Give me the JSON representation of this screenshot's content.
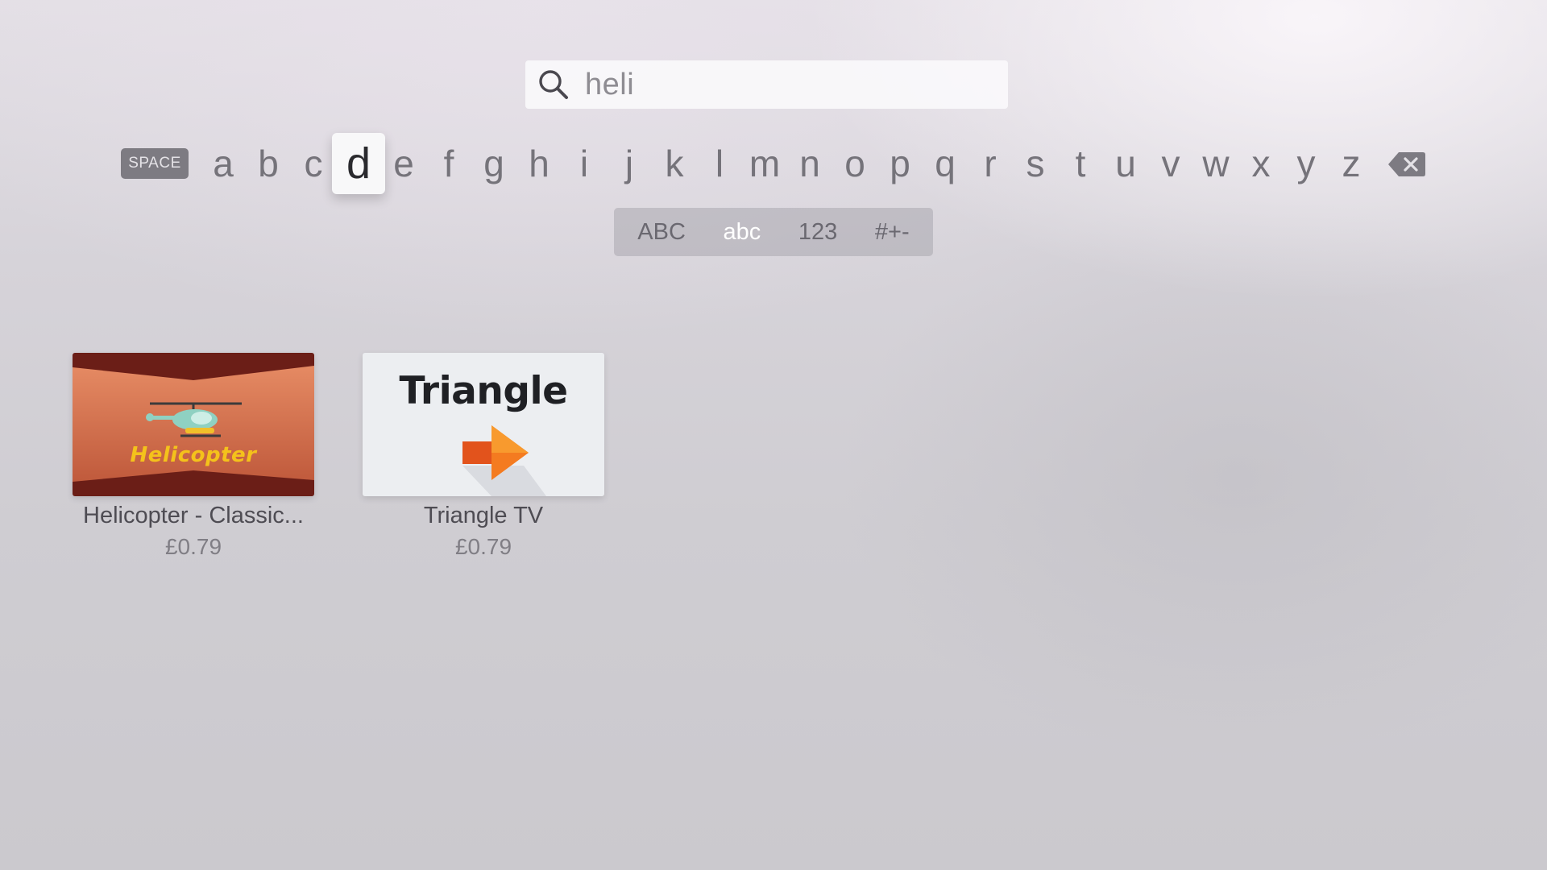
{
  "search": {
    "icon": "search-icon",
    "query": "heli"
  },
  "keyboard": {
    "space_label": "SPACE",
    "letters": [
      "a",
      "b",
      "c",
      "d",
      "e",
      "f",
      "g",
      "h",
      "i",
      "j",
      "k",
      "l",
      "m",
      "n",
      "o",
      "p",
      "q",
      "r",
      "s",
      "t",
      "u",
      "v",
      "w",
      "x",
      "y",
      "z"
    ],
    "focused_letter": "d",
    "delete_icon": "backspace-icon"
  },
  "modes": {
    "options": [
      "ABC",
      "abc",
      "123",
      "#+-"
    ],
    "active": "abc"
  },
  "results": [
    {
      "title": "Helicopter - Classic...",
      "price": "£0.79",
      "tile_text": "Helicopter",
      "icon": "helicopter-icon"
    },
    {
      "title": "Triangle TV",
      "price": "£0.79",
      "tile_text": "Triangle",
      "icon": "arrow-right-icon"
    }
  ],
  "colors": {
    "background": "#d6d3d9",
    "focus_key": "#f8f8f9",
    "helicopter_tile": "#c96a4c",
    "helicopter_text": "#f4c21b",
    "triangle_arrow": "#f47b20"
  }
}
